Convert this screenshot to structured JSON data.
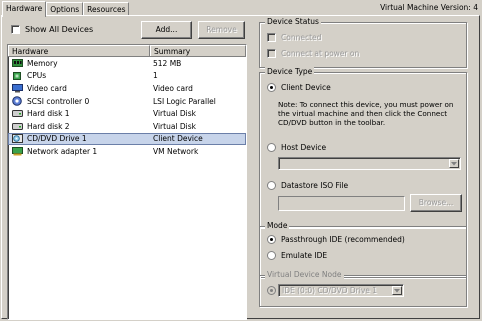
{
  "tabs": [
    {
      "label": "Hardware",
      "active": true
    },
    {
      "label": "Options",
      "active": false
    },
    {
      "label": "Resources",
      "active": false
    }
  ],
  "version_label": "Virtual Machine Version: 4",
  "show_all_devices": {
    "label": "Show All Devices",
    "checked": false
  },
  "buttons": {
    "add": "Add...",
    "remove": "Remove"
  },
  "hardware_list": {
    "columns": [
      "Hardware",
      "Summary"
    ],
    "rows": [
      {
        "name": "Memory",
        "summary": "512 MB",
        "icon": "memory-icon",
        "selected": false
      },
      {
        "name": "CPUs",
        "summary": "1",
        "icon": "cpu-icon",
        "selected": false
      },
      {
        "name": "Video card",
        "summary": "Video card",
        "icon": "video-card-icon",
        "selected": false
      },
      {
        "name": "SCSI controller 0",
        "summary": "LSI Logic Parallel",
        "icon": "scsi-controller-icon",
        "selected": false
      },
      {
        "name": "Hard disk 1",
        "summary": "Virtual Disk",
        "icon": "hard-disk-icon",
        "selected": false
      },
      {
        "name": "Hard disk 2",
        "summary": "Virtual Disk",
        "icon": "hard-disk-icon",
        "selected": false
      },
      {
        "name": "CD/DVD Drive 1",
        "summary": "Client Device",
        "icon": "cd-dvd-drive-icon",
        "selected": true
      },
      {
        "name": "Network adapter 1",
        "summary": "VM Network",
        "icon": "network-adapter-icon",
        "selected": false
      }
    ]
  },
  "device_status": {
    "title": "Device Status",
    "connected": {
      "label": "Connected",
      "checked": false,
      "enabled": false
    },
    "connect_at_power_on": {
      "label": "Connect at power on",
      "checked": false,
      "enabled": false
    }
  },
  "device_type": {
    "title": "Device Type",
    "client_device": {
      "label": "Client Device",
      "selected": true
    },
    "note": "Note: To connect this device, you must power on the virtual machine and then click the Connect CD/DVD button in the toolbar.",
    "host_device": {
      "label": "Host Device",
      "selected": false,
      "value": ""
    },
    "datastore_iso": {
      "label": "Datastore ISO File",
      "selected": false,
      "value": ""
    },
    "browse_label": "Browse..."
  },
  "mode": {
    "title": "Mode",
    "passthrough": {
      "label": "Passthrough IDE (recommended)",
      "selected": true
    },
    "emulate": {
      "label": "Emulate IDE",
      "selected": false
    }
  },
  "virtual_device_node": {
    "title": "Virtual Device Node",
    "value": "IDE (0:0) CD/DVD Drive 1"
  },
  "colors": {
    "background": "#d4d0c8",
    "selection": "#c7d4ea",
    "selection_border": "#6b7fa8"
  }
}
